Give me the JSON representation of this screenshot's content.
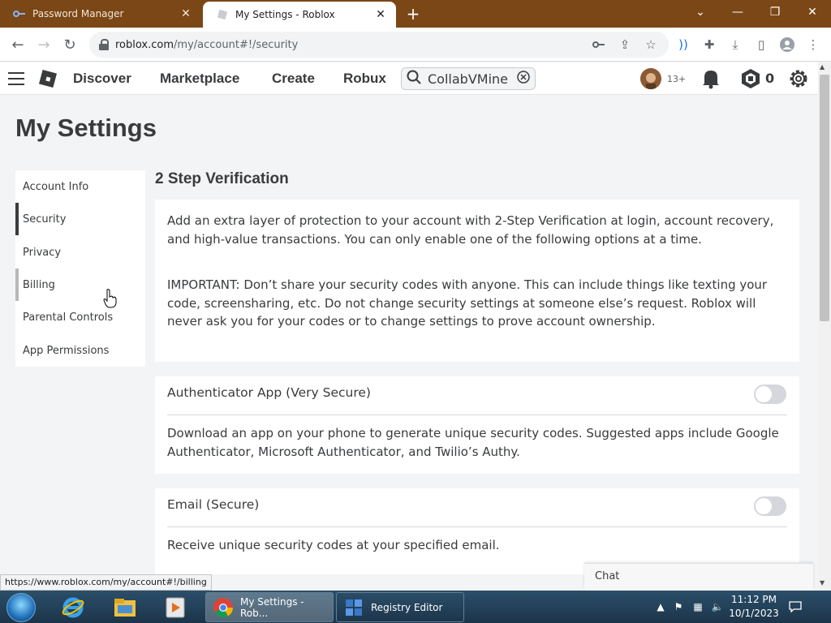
{
  "browser": {
    "tabs": [
      {
        "title": "Password Manager"
      },
      {
        "title": "My Settings - Roblox"
      }
    ],
    "url_host": "roblox.com",
    "url_path": "/my/account#!/security",
    "status_url": "https://www.roblox.com/my/account#!/billing"
  },
  "header": {
    "nav": [
      "Discover",
      "Marketplace",
      "Create",
      "Robux"
    ],
    "search_value": "CollabVMine",
    "age_label": "13+",
    "robux": "0"
  },
  "page": {
    "title": "My Settings",
    "menu": [
      "Account Info",
      "Security",
      "Privacy",
      "Billing",
      "Parental Controls",
      "App Permissions"
    ],
    "section_title": "2 Step Verification",
    "intro": "Add an extra layer of protection to your account with 2-Step Verification at login, account recovery, and high-value transactions. You can only enable one of the following options at a time.",
    "important": "IMPORTANT: Don’t share your security codes with anyone. This can include things like texting your code, screensharing, etc. Do not change security settings at someone else’s request. Roblox will never ask you for your codes or to change settings to prove account ownership.",
    "options": [
      {
        "title": "Authenticator App (Very Secure)",
        "desc": "Download an app on your phone to generate unique security codes. Suggested apps include Google Authenticator, Microsoft Authenticator, and Twilio’s Authy.",
        "enabled": false
      },
      {
        "title": "Email (Secure)",
        "desc": "Receive unique security codes at your specified email.",
        "enabled": false
      }
    ],
    "chat": "Chat"
  },
  "taskbar": {
    "tasks": [
      "My Settings - Rob...",
      "Registry Editor"
    ],
    "time": "11:12 PM",
    "date": "10/1/2023"
  },
  "colors": {
    "chrome_frame": "#7b4716",
    "page_bg": "#f2f4f5",
    "text": "#393b3d"
  }
}
